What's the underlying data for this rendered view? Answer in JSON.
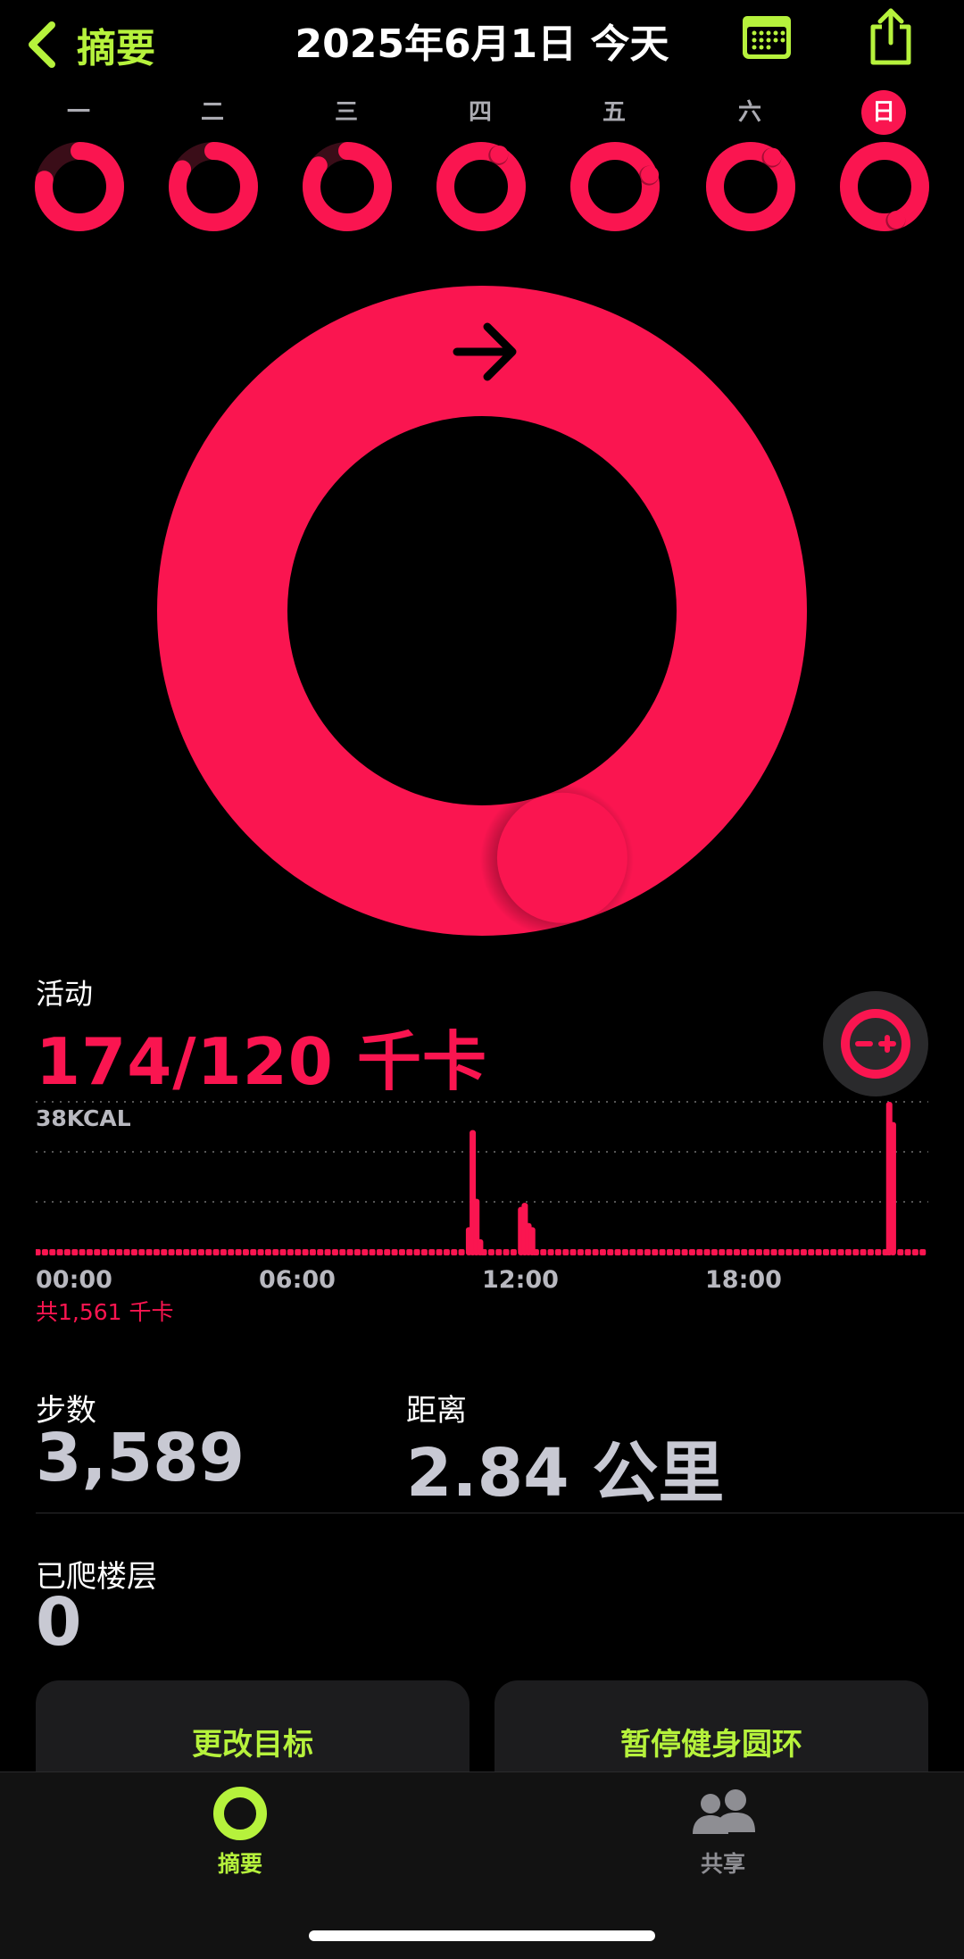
{
  "header": {
    "back_label": "摘要",
    "title": "2025年6月1日 今天"
  },
  "week": {
    "days": [
      "一",
      "二",
      "三",
      "四",
      "五",
      "六",
      "日"
    ],
    "today_index": 6,
    "progress": [
      0.78,
      0.83,
      0.85,
      1.08,
      1.2,
      1.1,
      1.45
    ]
  },
  "move_ring": {
    "progress": 1.45,
    "color": "#fa1550"
  },
  "activity": {
    "label": "活动",
    "value": "174/120 千卡",
    "chart_ymax": "38KCAL",
    "ticks": [
      "00:00",
      "06:00",
      "12:00",
      "18:00"
    ],
    "total": "共1,561 千卡"
  },
  "chart_data": {
    "type": "bar",
    "x_unit": "time of day",
    "y_unit": "KCAL",
    "ylim": [
      0,
      38
    ],
    "ymax_label": "38KCAL",
    "xticks": [
      "00:00",
      "06:00",
      "12:00",
      "18:00"
    ],
    "values": [
      0,
      0,
      0,
      0,
      0,
      0,
      0,
      0,
      0,
      0,
      0,
      0,
      0,
      0,
      0,
      0,
      0,
      0,
      0,
      0,
      0,
      0,
      0,
      0,
      0,
      0,
      0,
      0,
      0,
      0,
      0,
      0,
      0,
      0,
      0,
      0,
      0,
      0,
      0,
      0,
      0,
      0,
      0,
      0,
      0,
      0,
      0,
      0,
      0,
      0,
      0,
      0,
      0,
      0,
      0,
      0,
      0,
      0,
      0,
      0,
      0,
      0,
      0,
      0,
      0,
      0,
      0,
      0,
      0,
      0,
      0,
      0,
      0,
      0,
      0,
      0,
      0,
      0,
      0,
      0,
      0,
      0,
      0,
      0,
      0,
      0,
      0,
      0,
      0,
      0,
      0,
      0,
      0,
      0,
      0,
      0,
      0,
      0,
      0,
      0,
      0,
      0,
      0,
      0,
      0,
      0,
      0,
      0,
      0,
      0,
      0,
      0,
      0,
      0,
      0,
      0,
      7,
      31,
      14,
      4,
      0,
      0,
      0,
      0,
      0,
      0,
      0,
      0,
      0,
      0,
      12,
      13,
      8,
      7,
      0,
      0,
      0,
      0,
      0,
      0,
      0,
      0,
      0,
      0,
      0,
      0,
      0,
      0,
      0,
      0,
      0,
      0,
      0,
      0,
      0,
      0,
      0,
      0,
      0,
      0,
      0,
      0,
      0,
      0,
      0,
      0,
      0,
      0,
      0,
      0,
      0,
      0,
      0,
      0,
      0,
      0,
      0,
      0,
      0,
      0,
      0,
      0,
      0,
      0,
      0,
      0,
      0,
      0,
      0,
      0,
      0,
      0,
      0,
      0,
      0,
      0,
      0,
      0,
      0,
      0,
      0,
      0,
      0,
      0,
      0,
      0,
      0,
      0,
      0,
      0,
      0,
      0,
      0,
      0,
      0,
      0,
      0,
      0,
      0,
      0,
      0,
      0,
      0,
      0,
      0,
      0,
      0,
      0,
      0,
      38,
      33,
      0,
      0,
      0,
      0,
      0,
      0,
      0,
      0,
      0
    ],
    "color": "#fa1550",
    "total": "共1,561 千卡"
  },
  "steps": {
    "label": "步数",
    "value": "3,589"
  },
  "distance": {
    "label": "距离",
    "value": "2.84 公里"
  },
  "floors": {
    "label": "已爬楼层",
    "value": "0"
  },
  "buttons": {
    "change_goal": "更改目标",
    "pause_rings": "暂停健身圆环"
  },
  "tabs": [
    {
      "label": "摘要",
      "active": true,
      "icon": "activity-rings-icon"
    },
    {
      "label": "共享",
      "active": false,
      "icon": "people-icon"
    }
  ],
  "colors": {
    "accent": "#b6f23c",
    "move": "#fa1550",
    "inactive": "#8e8e93"
  }
}
